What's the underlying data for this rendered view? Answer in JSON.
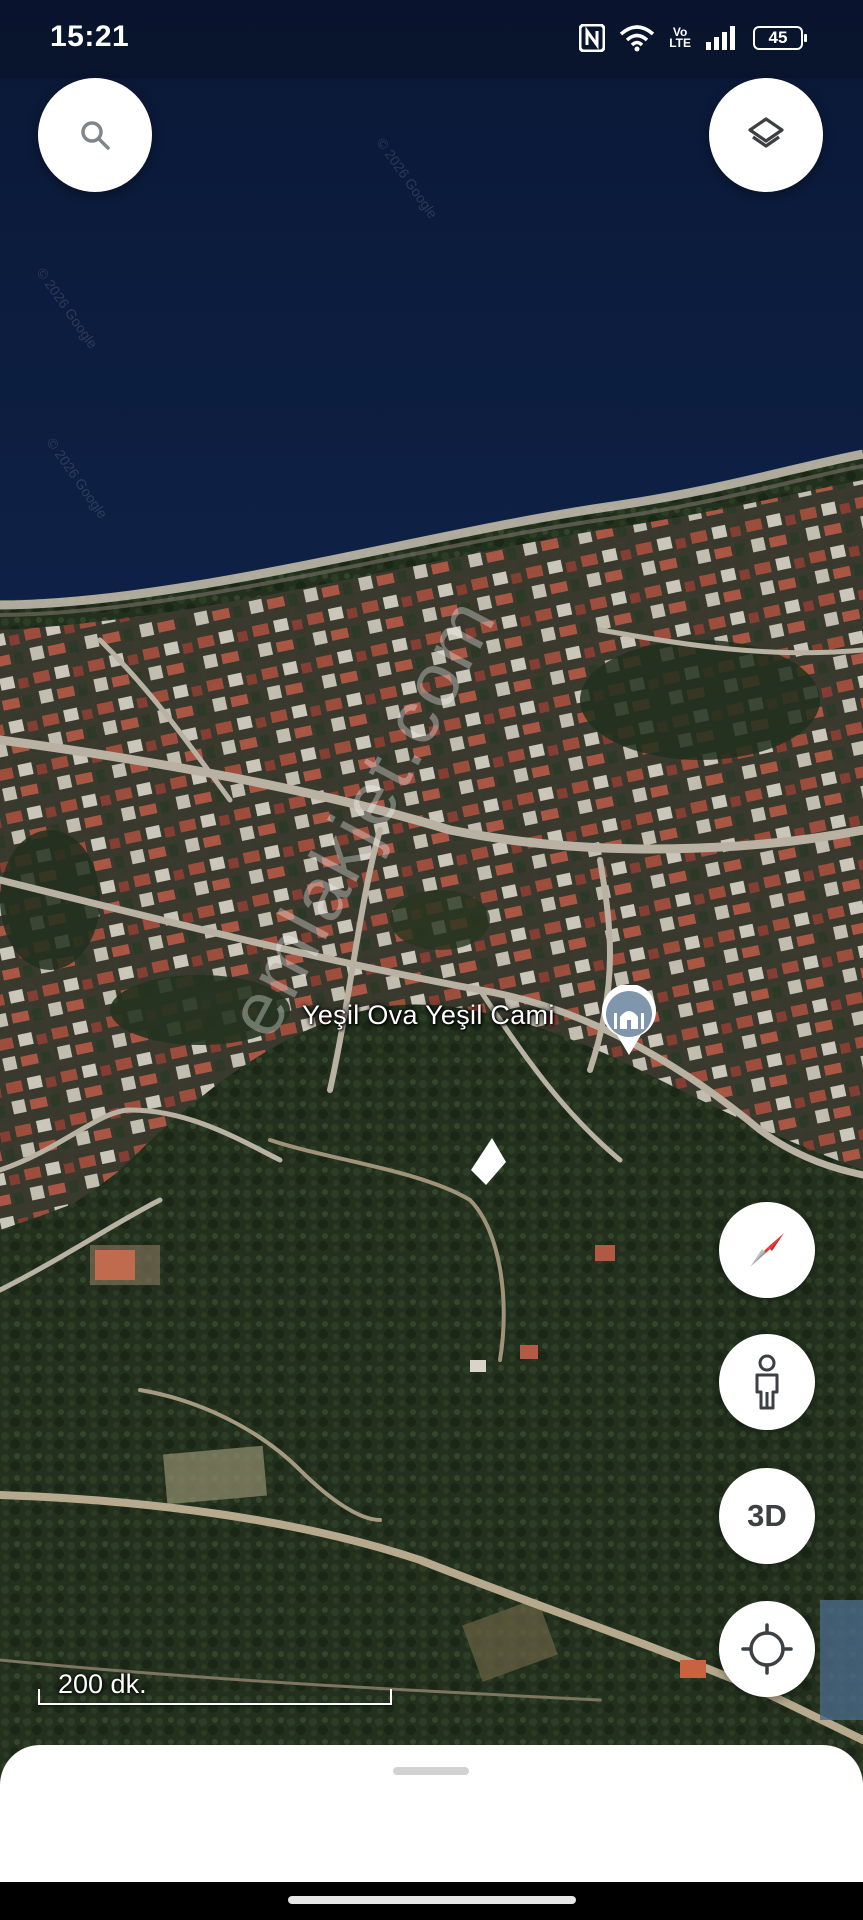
{
  "status_bar": {
    "time": "15:21",
    "volte_top": "Vo",
    "volte_bottom": "LTE",
    "battery_level": "45",
    "icons": [
      "nfc-icon",
      "wifi-icon",
      "volte-icon",
      "signal-icon",
      "battery-icon"
    ]
  },
  "map": {
    "type": "satellite",
    "place_label": "Yeşil Ova Yeşil Cami",
    "place_category_icon": "mosque-icon",
    "watermark": "emlakjet.com",
    "map_copyright": "© 2026 Google",
    "scale_label": "200 dk."
  },
  "controls": {
    "search_icon": "search-icon",
    "layers_icon": "layers-icon",
    "compass_icon": "compass-icon",
    "street_view_icon": "pegman-icon",
    "three_d_label": "3D",
    "my_location_icon": "crosshair-icon"
  },
  "colors": {
    "sea": "#0b1a3a",
    "vegetation": "#24331f",
    "roads": "#b9b2a3",
    "rooftops": "#9a4a3c",
    "control_background": "#ffffff",
    "compass_red": "#e53935"
  }
}
